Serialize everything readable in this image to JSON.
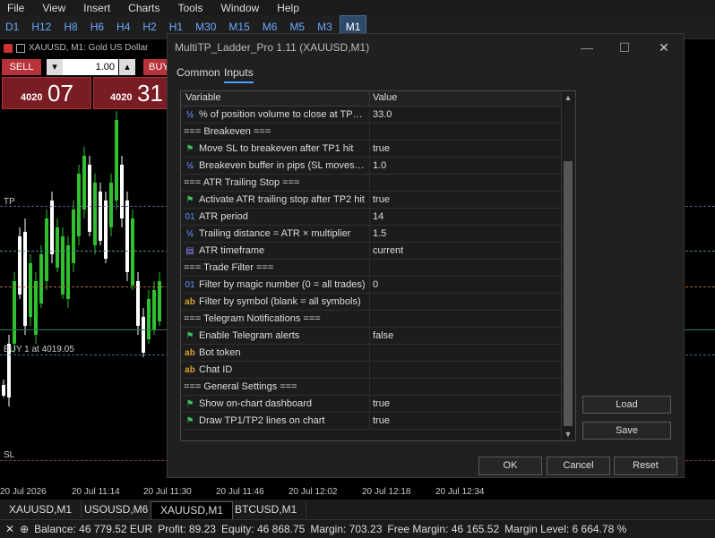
{
  "menu": [
    "File",
    "View",
    "Insert",
    "Charts",
    "Tools",
    "Window",
    "Help"
  ],
  "timeframes": [
    {
      "label": "D1",
      "active": false
    },
    {
      "label": "H12",
      "active": false
    },
    {
      "label": "H8",
      "active": false
    },
    {
      "label": "H6",
      "active": false
    },
    {
      "label": "H4",
      "active": false
    },
    {
      "label": "H2",
      "active": false
    },
    {
      "label": "H1",
      "active": false
    },
    {
      "label": "M30",
      "active": false
    },
    {
      "label": "M15",
      "active": false
    },
    {
      "label": "M6",
      "active": false
    },
    {
      "label": "M5",
      "active": false
    },
    {
      "label": "M3",
      "active": false
    },
    {
      "label": "M1",
      "active": true
    }
  ],
  "chart": {
    "title": "XAUUSD, M1:  Gold US Dollar",
    "sell_label": "SELL",
    "buy_label": "BUY",
    "volume": "1.00",
    "bid_small": "4020",
    "bid_big": "07",
    "ask_small": "4020",
    "ask_big": "31",
    "tp_label": "TP",
    "buy_line_label": "BUY 1 at 4019.05",
    "sl_label": "SL",
    "time_labels": [
      "20 Jul 2026",
      "20 Jul 11:14",
      "20 Jul 11:30",
      "20 Jul 11:46",
      "20 Jul 12:02",
      "20 Jul 12:18",
      "20 Jul 12:34"
    ]
  },
  "chart_tabs": [
    {
      "label": "XAUUSD,M1",
      "active": false
    },
    {
      "label": "USOUSD,M6",
      "active": false
    },
    {
      "label": "XAUUSD,M1",
      "active": true
    },
    {
      "label": "BTCUSD,M1",
      "active": false
    }
  ],
  "status": {
    "close_glyph": "✕",
    "add_glyph": "⊕",
    "balance": "Balance: 46 779.52 EUR",
    "profit": "Profit: 89.23",
    "equity": "Equity: 46 868.75",
    "margin": "Margin: 703.23",
    "free_margin": "Free Margin: 46 165.52",
    "margin_level": "Margin Level: 6 664.78 %"
  },
  "dialog": {
    "title": "MultiTP_Ladder_Pro 1.11 (XAUUSD,M1)",
    "tabs": [
      {
        "label": "Common",
        "active": false
      },
      {
        "label": "Inputs",
        "active": true
      }
    ],
    "columns": {
      "variable": "Variable",
      "value": "Value"
    },
    "rows": [
      {
        "type": "half",
        "name": "% of position volume to close at TP2 (...",
        "value": "33.0"
      },
      {
        "type": "section",
        "name": "=== Breakeven ===",
        "value": ""
      },
      {
        "type": "bool",
        "name": "Move SL to breakeven after TP1 hit",
        "value": "true"
      },
      {
        "type": "half",
        "name": "Breakeven buffer in pips (SL moves to ...",
        "value": "1.0"
      },
      {
        "type": "section",
        "name": "=== ATR Trailing Stop ===",
        "value": ""
      },
      {
        "type": "bool",
        "name": "Activate ATR trailing stop after TP2 hit",
        "value": "true"
      },
      {
        "type": "int",
        "name": "ATR period",
        "value": "14"
      },
      {
        "type": "half",
        "name": "Trailing distance = ATR × multiplier",
        "value": "1.5"
      },
      {
        "type": "enum",
        "name": "ATR timeframe",
        "value": "current"
      },
      {
        "type": "section",
        "name": "=== Trade Filter ===",
        "value": ""
      },
      {
        "type": "int",
        "name": "Filter by magic number (0 = all trades)",
        "value": "0"
      },
      {
        "type": "str",
        "name": "Filter by symbol (blank = all symbols)",
        "value": ""
      },
      {
        "type": "section",
        "name": "=== Telegram Notifications ===",
        "value": ""
      },
      {
        "type": "bool",
        "name": "Enable Telegram alerts",
        "value": "false"
      },
      {
        "type": "str",
        "name": "Bot token",
        "value": ""
      },
      {
        "type": "str",
        "name": "Chat ID",
        "value": ""
      },
      {
        "type": "section",
        "name": "=== General Settings ===",
        "value": ""
      },
      {
        "type": "bool",
        "name": "Show on-chart dashboard",
        "value": "true"
      },
      {
        "type": "bool",
        "name": "Draw TP1/TP2 lines on chart",
        "value": "true"
      }
    ],
    "buttons": {
      "load": "Load",
      "save": "Save",
      "ok": "OK",
      "cancel": "Cancel",
      "reset": "Reset"
    }
  }
}
